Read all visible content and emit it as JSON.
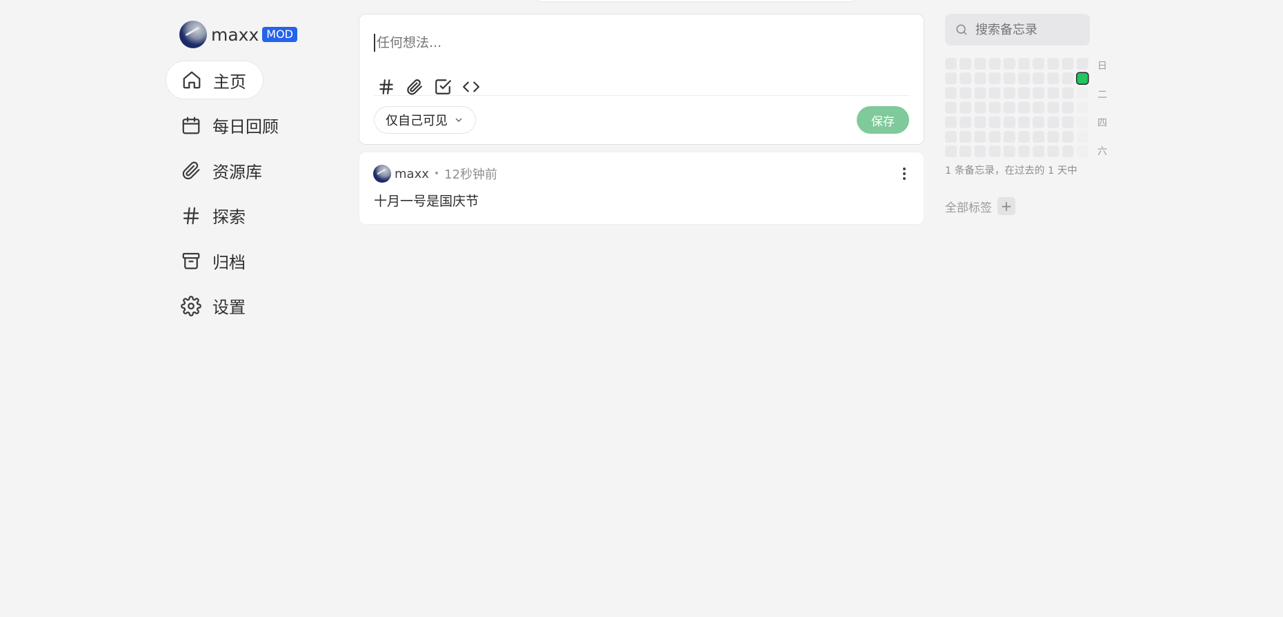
{
  "sidebar": {
    "user": {
      "name": "maxx",
      "badge": "MOD"
    },
    "items": [
      {
        "label": "主页",
        "icon": "home-icon",
        "active": true
      },
      {
        "label": "每日回顾",
        "icon": "calendar-icon",
        "active": false
      },
      {
        "label": "资源库",
        "icon": "paperclip-icon",
        "active": false
      },
      {
        "label": "探索",
        "icon": "hash-icon",
        "active": false
      },
      {
        "label": "归档",
        "icon": "archive-icon",
        "active": false
      },
      {
        "label": "设置",
        "icon": "gear-icon",
        "active": false
      }
    ]
  },
  "editor": {
    "placeholder": "任何想法...",
    "tools": [
      "hash-icon",
      "paperclip-icon",
      "checkbox-icon",
      "code-icon"
    ],
    "visibility": "仅自己可见",
    "save_label": "保存"
  },
  "memo": {
    "author": "maxx",
    "separator": "•",
    "time": "12秒钟前",
    "content": "十月一号是国庆节"
  },
  "search": {
    "placeholder": "搜索备忘录"
  },
  "heatmap": {
    "weekday_labels": [
      "日",
      "二",
      "四",
      "六"
    ],
    "summary": "1 条备忘录，在过去的 1 天中",
    "active_color": "#22c55e",
    "empty_color": "#e8e8ea",
    "future_color": "#f0f0f1"
  },
  "tags": {
    "title": "全部标签",
    "add_label": "+"
  }
}
